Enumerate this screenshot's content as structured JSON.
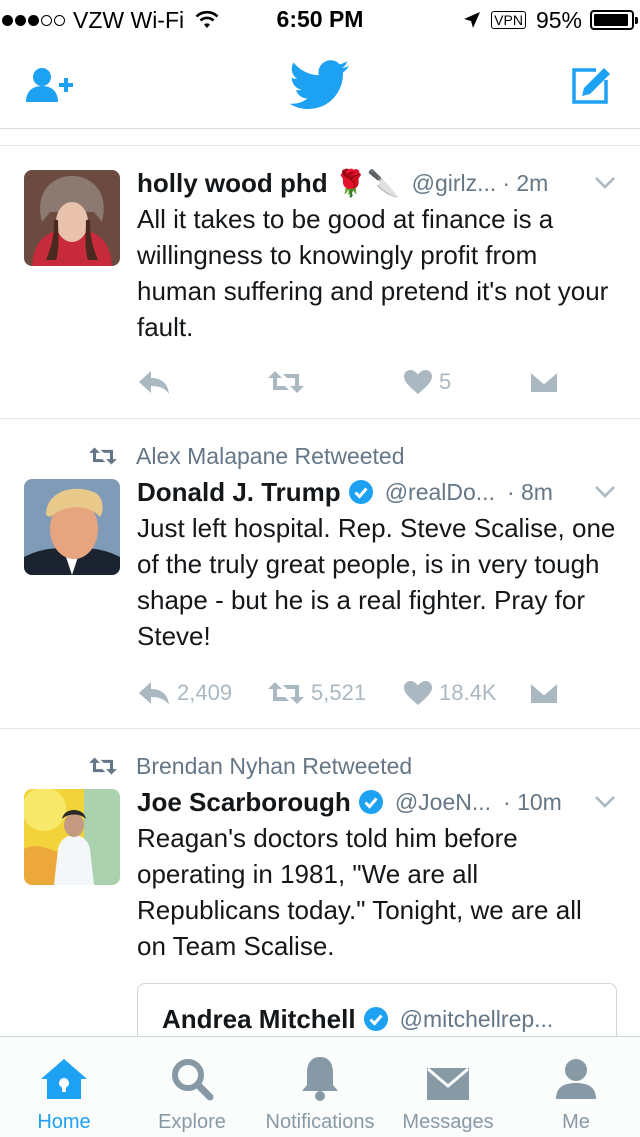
{
  "status_bar": {
    "carrier": "VZW Wi-Fi",
    "time": "6:50 PM",
    "vpn": "VPN",
    "battery": "95%",
    "battery_level": 0.95
  },
  "nav": {
    "left_icon": "add-user-icon",
    "center_icon": "twitter-bird-icon",
    "right_icon": "compose-icon"
  },
  "colors": {
    "brand": "#1da1f2",
    "text": "#14171a",
    "secondary": "#657786",
    "action_gray": "#aab8c2"
  },
  "tweets": [
    {
      "retweeted_by": "",
      "name": "holly wood phd 🌹🔪",
      "handle": "@girlz...",
      "time": "· 2m",
      "text": "All it takes to be good at finance is a willingness to knowingly profit from human suffering and pretend it's not your fault.",
      "replies": "",
      "retweets": "",
      "likes": "5"
    },
    {
      "retweeted_by": "Alex Malapane Retweeted",
      "name": "Donald J. Trump",
      "verified": true,
      "handle": "@realDo...",
      "time": "· 8m",
      "text": "Just left hospital. Rep. Steve Scalise, one of the truly great people, is in very tough shape - but he is a real fighter. Pray for Steve!",
      "replies": "2,409",
      "retweets": "5,521",
      "likes": "18.4K"
    },
    {
      "retweeted_by": "Brendan Nyhan Retweeted",
      "name": "Joe Scarborough",
      "verified": true,
      "handle": "@JoeN...",
      "time": "· 10m",
      "text": "Reagan's doctors told him before operating in 1981, \"We are all Republicans today.\" Tonight, we are all on Team Scalise.",
      "quoted": {
        "name": "Andrea Mitchell",
        "verified": true,
        "handle": "@mitchellrep..."
      }
    }
  ],
  "tabbar": [
    {
      "label": "Home",
      "icon": "home-icon",
      "active": true
    },
    {
      "label": "Explore",
      "icon": "search-icon",
      "active": false
    },
    {
      "label": "Notifications",
      "icon": "bell-icon",
      "active": false
    },
    {
      "label": "Messages",
      "icon": "envelope-icon",
      "active": false
    },
    {
      "label": "Me",
      "icon": "profile-icon",
      "active": false
    }
  ]
}
